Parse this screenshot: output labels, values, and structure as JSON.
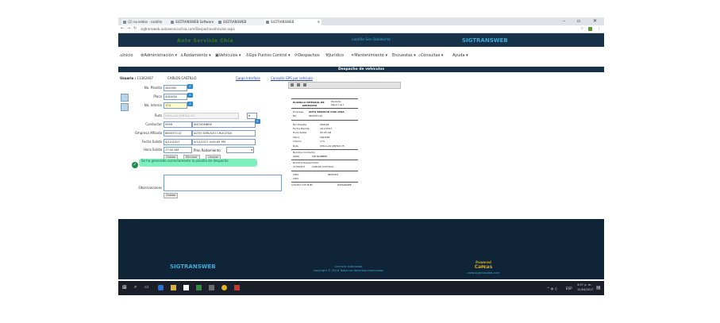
{
  "browser": {
    "tabs": [
      {
        "label": "(2) no leídos - castillo"
      },
      {
        "label": "SIGTRANSWEB Software"
      },
      {
        "label": "SIGTRANSWEB"
      },
      {
        "label": "SIGTRANSWEB"
      }
    ],
    "url": "sigtransweb.autoserviciochia.com/Despachovehiculos.aspx",
    "window_controls": {
      "minimize": "–",
      "maximize": "▫",
      "close": "✕"
    }
  },
  "site_header": {
    "brand_left": "Auto Servicio Chía",
    "user_greeting": "castillo Sen Balaberta",
    "brand_right": "SIGTRANSWEB"
  },
  "menu": [
    {
      "label": "Inicio",
      "icon": "home-icon"
    },
    {
      "label": "Administración ▾",
      "icon": "gear-icon"
    },
    {
      "label": "Rodamiento ▾",
      "icon": "walk-icon"
    },
    {
      "label": "Vehículos ▾",
      "icon": "bus-icon"
    },
    {
      "label": "Gps Puntos Control ▾",
      "icon": "pin-icon"
    },
    {
      "label": "Despachos",
      "icon": "refresh-icon"
    },
    {
      "label": "Jurídico",
      "icon": "hammer-icon"
    },
    {
      "label": "Mantenimiento ▾",
      "icon": "wrench-icon"
    },
    {
      "label": "Encuestas ▾",
      "icon": ""
    },
    {
      "label": "Consultas ▾",
      "icon": "search-icon"
    },
    {
      "label": "Ayuda ▾",
      "icon": ""
    }
  ],
  "page_title": "Despacho de vehículos",
  "form": {
    "usuario_label": "Usuario :",
    "usuario_id": "11342407",
    "usuario_name": "CARLOS CASTILLO",
    "cargo_link": "Cargo Interfase",
    "gps_link": "Consulta GPS por vehículo",
    "planilla_label": "No. Planilla",
    "planilla_value": "260198",
    "placa_label": "Placa",
    "placa_value": "SQD036",
    "interno_label": "No. Interno",
    "interno_value": "174",
    "ruta_label": "Ruta",
    "ruta_value": "CHIA-LAS JUNTAS V5",
    "ruta_num": "6",
    "conductor_label": "Conductor",
    "conductor_code": "9999",
    "conductor_name": "SIN NOMBRE",
    "empresa_label": "Empresa Afiliada",
    "empresa_code": "860037110",
    "empresa_name": "AUTO SERVICIO CHIA LTDA",
    "fecha_label": "Fecha Salida",
    "fecha_value": "4/12/2017",
    "fecha_full": "4/12/2017 4:00:45 PM",
    "hora_label": "Hora Salida",
    "hora_value": "17:00 AM",
    "plan_label": "Plan Rodamiento",
    "btn_grabar": "Grabar",
    "btn_eliminar": "Eliminar",
    "btn_limpiar": "Limpiar",
    "success_msg": "Se ha generado correctamente la planilla de despacho.",
    "obs_label": "Observaciones",
    "btn_grabar2": "Grabar"
  },
  "preview": {
    "title1": "PLANILLA INTEGRAL DE",
    "title2": "DESPACHO",
    "small1": "Planilla No.",
    "small2": "Página 1 de 1",
    "empresa_lbl": "Empresa",
    "empresa_val": "AUTO SERVICIO CHIA LTDA",
    "nit_lbl": "Nit",
    "nit_val": "860037110",
    "rows": [
      {
        "k": "Nro Planilla",
        "v": "260198"
      },
      {
        "k": "Fecha Planilla",
        "v": "4/12/2017"
      },
      {
        "k": "Hora Salida",
        "v": "05:05 AM"
      },
      {
        "k": "Placa",
        "v": "SQD036"
      },
      {
        "k": "Interno",
        "v": "174"
      },
      {
        "k": "Ruta",
        "v": "CHIA-LAS JUNTAS V5"
      }
    ],
    "cond_lbl": "Nombre Conductor",
    "cond_code": "9999",
    "cond_name": "SIN NOMBRE",
    "desp_lbl": "Nombre Despachador",
    "desp_code": "11342407",
    "desp_name": "CARLOS CASTILLO",
    "chia1": "CHIA",
    "chia_num": "8633333",
    "chia2": "CHIA",
    "foot_date": "4/12/2017 4:55:38 PM",
    "foot_brand": "SIGTRANSWEB"
  },
  "footer": {
    "brand": "SIGTRANSWEB",
    "line1": "Licencia autorizada",
    "line2": "copyright © 2016 Todos los derechos reservados",
    "powered": "Powered by",
    "company": "Carcas",
    "url": "www.sigtransweb.com"
  },
  "taskbar": {
    "lang": "ESP",
    "time": "4:57 p. m.",
    "date": "12/04/2017"
  },
  "colors": {
    "header_bg": "#173248",
    "footer_bg": "#0f2437",
    "accent_blue": "#3fa9d9",
    "toast_green": "#7fefc0"
  }
}
